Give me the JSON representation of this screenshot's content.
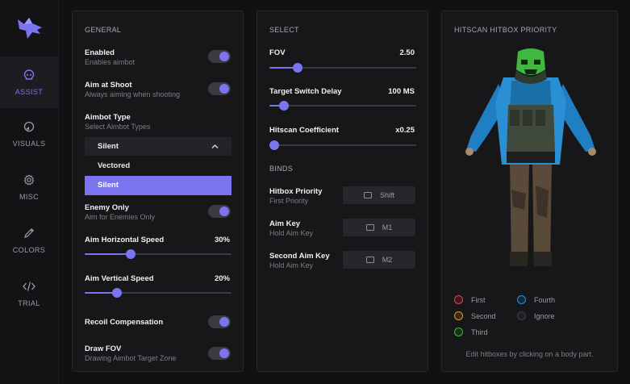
{
  "sidebar": {
    "items": [
      {
        "label": "ASSIST",
        "icon": "skull-icon",
        "active": true
      },
      {
        "label": "VISUALS",
        "icon": "eye-icon",
        "active": false
      },
      {
        "label": "MISC",
        "icon": "gear-icon",
        "active": false
      },
      {
        "label": "COLORS",
        "icon": "eyedropper-icon",
        "active": false
      },
      {
        "label": "TRIAL",
        "icon": "code-icon",
        "active": false
      }
    ]
  },
  "general": {
    "title": "GENERAL",
    "enabled": {
      "label": "Enabled",
      "sub": "Enables aimbot",
      "on": true
    },
    "aim_at_shoot": {
      "label": "Aim at Shoot",
      "sub": "Always aiming when shooting",
      "on": true
    },
    "aimbot_type": {
      "label": "Aimbot Type",
      "sub": "Select Aimbot Types",
      "selected": "Silent",
      "options": [
        "Vectored",
        "Silent"
      ]
    },
    "enemy_only": {
      "label": "Enemy Only",
      "sub": "Aim for Enemies Only",
      "on": true
    },
    "aim_h_speed": {
      "label": "Aim Horizontal Speed",
      "value": "30%",
      "fraction": 0.3
    },
    "aim_v_speed": {
      "label": "Aim Vertical Speed",
      "value": "20%",
      "fraction": 0.2
    },
    "recoil": {
      "label": "Recoil Compensation",
      "on": true
    },
    "draw_fov": {
      "label": "Draw FOV",
      "sub": "Drawing Aimbot Target Zone",
      "on": true
    }
  },
  "select": {
    "title": "SELECT",
    "fov": {
      "label": "FOV",
      "value": "2.50",
      "fraction": 0.17
    },
    "switch_delay": {
      "label": "Target Switch Delay",
      "value": "100 MS",
      "fraction": 0.07
    },
    "hitscan_coef": {
      "label": "Hitscan Coefficient",
      "value": "x0.25",
      "fraction": 0.0
    },
    "binds_title": "BINDS",
    "hitbox_priority": {
      "label": "Hitbox Priority",
      "sub": "First Priority",
      "key": "Shift"
    },
    "aim_key": {
      "label": "Aim Key",
      "sub": "Hold Aim Key",
      "key": "M1"
    },
    "second_aim_key": {
      "label": "Second Aim Key",
      "sub": "Hold Aim Key",
      "key": "M2"
    }
  },
  "hitbox": {
    "title": "HITSCAN HITBOX PRIORITY",
    "legend": [
      {
        "label": "First",
        "color": "#e0454f"
      },
      {
        "label": "Fourth",
        "color": "#2d8fd6"
      },
      {
        "label": "Second",
        "color": "#e0962f"
      },
      {
        "label": "Ignore",
        "color": "#3e3e46"
      },
      {
        "label": "Third",
        "color": "#3fb83f"
      }
    ],
    "hint": "Edit hitboxes by clicking on a body part."
  },
  "colors": {
    "accent": "#7b74f0",
    "background": "#111113",
    "panel": "#17171a"
  }
}
